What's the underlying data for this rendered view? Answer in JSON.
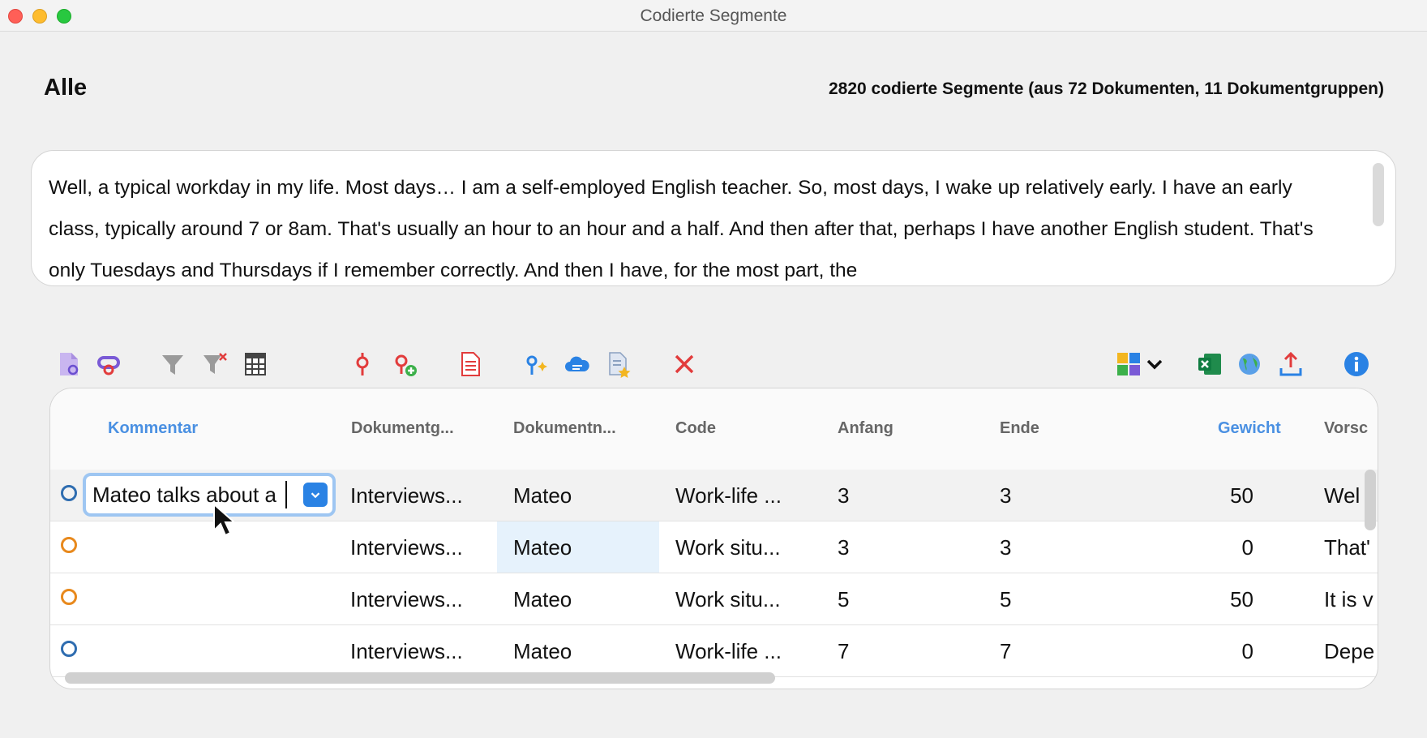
{
  "window": {
    "title": "Codierte Segmente"
  },
  "header": {
    "filter_label": "Alle",
    "segment_count": "2820 codierte Segmente (aus 72 Dokumenten, 11 Dokumentgruppen)"
  },
  "preview": {
    "text": "Well, a typical workday in my life. Most days… I am a self-employed English teacher. So, most days, I wake up relatively early. I have an early class, typically around 7 or 8am. That's usually an hour to an hour and a half. And then after that, perhaps I have another English student. That's only Tuesdays and Thursdays if I remember correctly. And then I have, for the most part, the"
  },
  "toolbar": {
    "icons": [
      "document-memo-icon",
      "code-link-icon",
      "filter-icon",
      "remove-filter-icon",
      "column-settings-icon",
      "code-icon",
      "add-code-icon",
      "pdf-document-icon",
      "ai-assist-icon",
      "cloud-icon",
      "favorite-doc-icon",
      "delete-icon",
      "smart-coding-icon",
      "chevron-down-icon",
      "excel-icon",
      "globe-icon",
      "export-icon",
      "info-icon"
    ]
  },
  "table": {
    "columns": [
      {
        "label": "Kommentar",
        "active": true
      },
      {
        "label": "Dokumentg...",
        "active": false
      },
      {
        "label": "Dokumentn...",
        "active": false
      },
      {
        "label": "Code",
        "active": false
      },
      {
        "label": "Anfang",
        "active": false
      },
      {
        "label": "Ende",
        "active": false
      },
      {
        "label": "Gewicht",
        "active": true
      },
      {
        "label": "Vorsc",
        "active": false
      }
    ],
    "rows": [
      {
        "marker_color": "#2f6db0",
        "comment": "Mateo talks about a",
        "group": "Interviews...",
        "document": "Mateo",
        "code": "Work-life ...",
        "start": "3",
        "end": "3",
        "weight": "50",
        "preview": "Wel"
      },
      {
        "marker_color": "#e8891d",
        "comment": "",
        "group": "Interviews...",
        "document": "Mateo",
        "code": "Work situ...",
        "start": "3",
        "end": "3",
        "weight": "0",
        "preview": "That'"
      },
      {
        "marker_color": "#e8891d",
        "comment": "",
        "group": "Interviews...",
        "document": "Mateo",
        "code": "Work situ...",
        "start": "5",
        "end": "5",
        "weight": "50",
        "preview": "It is v"
      },
      {
        "marker_color": "#2f6db0",
        "comment": "",
        "group": "Interviews...",
        "document": "Mateo",
        "code": "Work-life ...",
        "start": "7",
        "end": "7",
        "weight": "0",
        "preview": "Depe"
      }
    ]
  },
  "colors": {
    "accent": "#2a82e4",
    "header_active": "#4a90e2",
    "selected_cell": "#e6f2fc"
  }
}
